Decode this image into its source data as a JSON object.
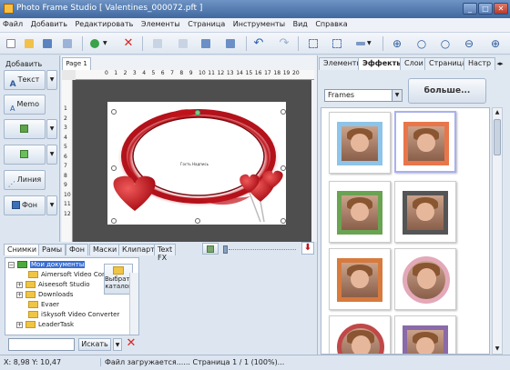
{
  "window": {
    "title": "Photo Frame Studio [ Valentines_000072.pft ]",
    "minimize": "_",
    "maximize": "□",
    "close": "✕"
  },
  "menu": [
    "Файл",
    "Добавить",
    "Редактировать",
    "Элементы",
    "Страница",
    "Инструменты",
    "Вид",
    "Справка"
  ],
  "left_panel": {
    "label": "Добавить",
    "buttons": [
      "Текст",
      "Memo",
      "",
      "",
      "Линия",
      "Фон"
    ],
    "dropdown_glyph": "▼"
  },
  "canvas": {
    "page_tab": "Page 1",
    "ruler_h": [
      "0",
      "1",
      "2",
      "3",
      "4",
      "5",
      "6",
      "7",
      "8",
      "9",
      "10",
      "11",
      "12",
      "13",
      "14",
      "15",
      "16",
      "17",
      "18",
      "19",
      "20"
    ],
    "ruler_v": [
      "1",
      "2",
      "3",
      "4",
      "5",
      "6",
      "7",
      "8",
      "9",
      "10",
      "11",
      "12"
    ],
    "frame_caption": "Гость Надпись"
  },
  "bottom_panel": {
    "tabs": [
      "Снимки",
      "Рамы",
      "Фон",
      "Маски",
      "Клипарт",
      "Text FX"
    ],
    "active_tab": 0,
    "tree_root": "Мои документы",
    "tree_items": [
      "Aimersoft Video Conv",
      "Aiseesoft Studio",
      "Downloads",
      "Evaer",
      "iSkysoft Video Converter",
      "LeaderTask"
    ],
    "choose_folder": "Выбрать каталог",
    "search_button": "Искать",
    "search_value": ""
  },
  "right_panel": {
    "tabs": [
      "Элементы",
      "Эффекты",
      "Слои",
      "Страница",
      "Настр"
    ],
    "active_tab": 1,
    "select_value": "Frames",
    "more_button": "больше...",
    "frame_colors": [
      "#8ec4e8",
      "#e8764a",
      "#6aa352",
      "#555555",
      "#d77a3e",
      "#e3a9b9",
      "#c04848",
      "#8a6aa8"
    ],
    "selected_index": 1
  },
  "status": {
    "coords": "X: 8,98 Y: 10,47",
    "message": "Файл загружается...... Страница 1 / 1 (100%)..."
  },
  "colors": {
    "title_bar": "#41699f",
    "accent_heart": "#c0141c"
  }
}
